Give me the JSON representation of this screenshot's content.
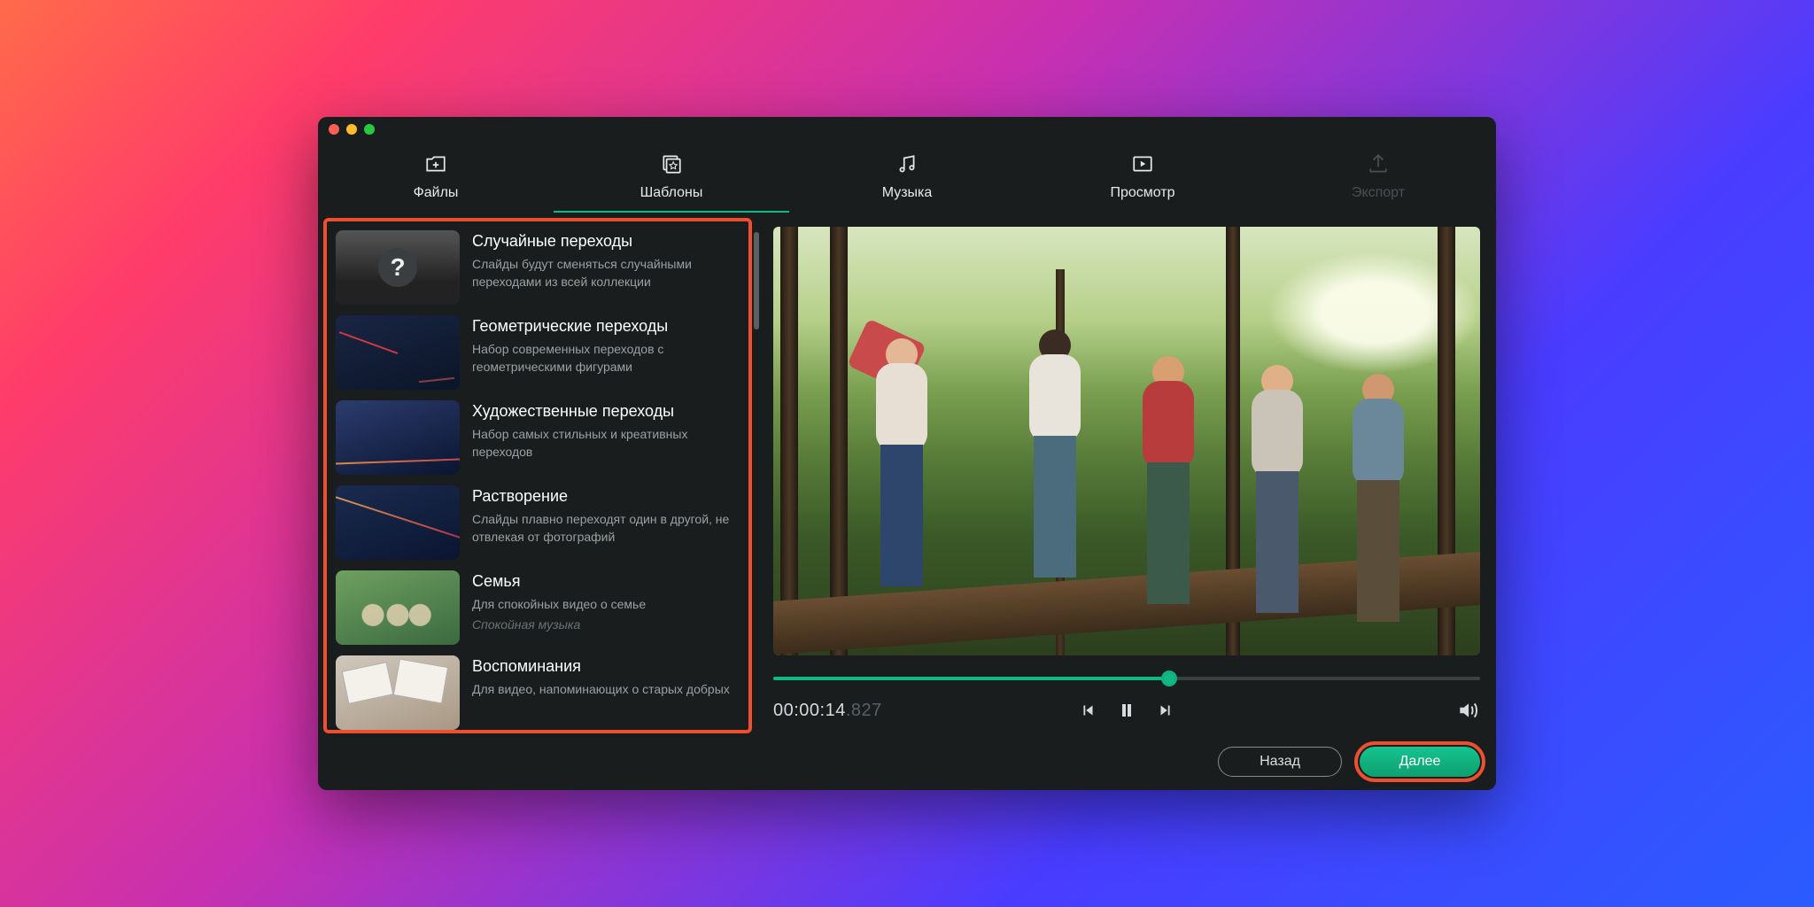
{
  "tabs": {
    "files": "Файлы",
    "templates": "Шаблоны",
    "music": "Музыка",
    "preview": "Просмотр",
    "export": "Экспорт"
  },
  "templates": [
    {
      "title": "Случайные переходы",
      "desc": "Слайды будут сменяться случайными переходами из всей коллекции",
      "hint": ""
    },
    {
      "title": "Геометрические переходы",
      "desc": "Набор современных переходов с геометрическими фигурами",
      "hint": ""
    },
    {
      "title": "Художественные переходы",
      "desc": "Набор самых стильных и креативных переходов",
      "hint": ""
    },
    {
      "title": "Растворение",
      "desc": "Слайды плавно переходят один в другой, не отвлекая от фотографий",
      "hint": ""
    },
    {
      "title": "Семья",
      "desc": "Для спокойных видео о семье",
      "hint": "Спокойная музыка"
    },
    {
      "title": "Воспоминания",
      "desc": "Для видео, напоминающих о старых добрых",
      "hint": ""
    }
  ],
  "playback": {
    "time_main": "00:00:14",
    "time_ms": ".827",
    "progress_percent": 56
  },
  "footer": {
    "back": "Назад",
    "next": "Далее"
  }
}
